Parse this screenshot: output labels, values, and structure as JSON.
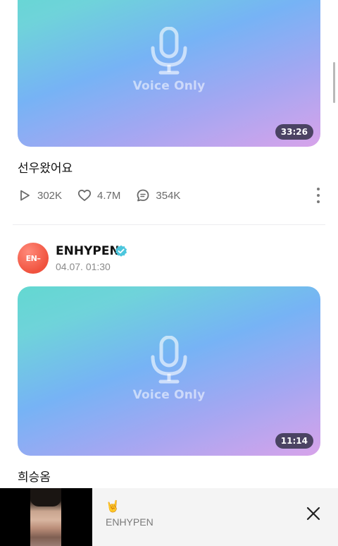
{
  "posts": [
    {
      "voice_label": "Voice Only",
      "duration": "33:26",
      "title": "선우왔어요",
      "stats": {
        "plays": "302K",
        "likes": "4.7M",
        "comments": "354K"
      }
    },
    {
      "voice_label": "Voice Only",
      "duration": "11:14",
      "title": "희승옴"
    }
  ],
  "post_header": {
    "avatar_text": "EN–",
    "artist": "ENHYPEN",
    "date": "04.07. 01:30"
  },
  "mini_player": {
    "artist": "ENHYPEN",
    "emoji": "🤘"
  },
  "colors": {
    "verified": "#4cc6dd",
    "avatar": "#f0523e",
    "gradient_start": "#63d8d1",
    "gradient_mid": "#76b3f5",
    "gradient_end": "#d7a3ea"
  }
}
